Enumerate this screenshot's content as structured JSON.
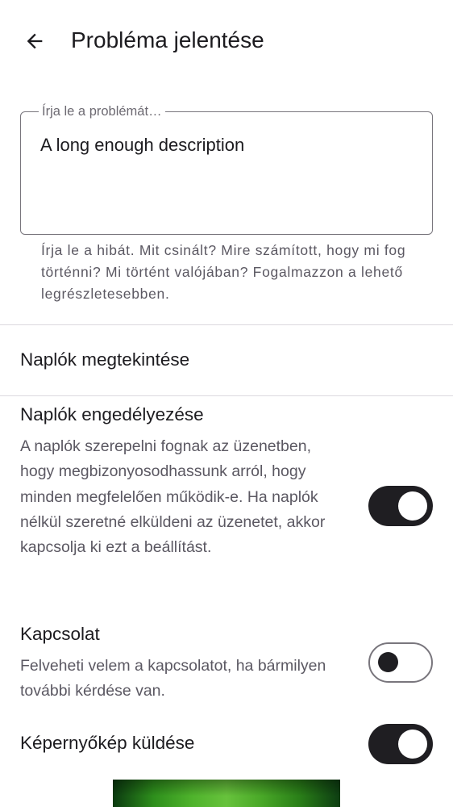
{
  "header": {
    "back_icon": "arrow-left-icon",
    "title": "Probléma jelentése"
  },
  "description_field": {
    "label": "Írja le a problémát…",
    "value": "A long enough description",
    "hint": "Írja le a hibát. Mit csinált? Mire számított, hogy mi fog történni? Mi történt valójában? Fogalmazzon a lehető legrészletesebben."
  },
  "view_logs": {
    "label": "Naplók megtekintése"
  },
  "enable_logs": {
    "title": "Naplók engedélyezése",
    "description": "A naplók szerepelni fognak az üzenetben, hogy megbizonyosodhassunk arról, hogy minden megfelelően működik-e. Ha naplók nélkül szeretné elküldeni az üzenetet, akkor kapcsolja ki ezt a beállítást.",
    "enabled": true
  },
  "contact": {
    "title": "Kapcsolat",
    "description": "Felveheti velem a kapcsolatot, ha bármilyen további kérdése van.",
    "enabled": false
  },
  "screenshot": {
    "title": "Képernyőkép küldése",
    "enabled": true
  },
  "colors": {
    "toggle_on": "#1f1e22",
    "outline": "#79767d",
    "secondary_text": "#5b5862"
  }
}
